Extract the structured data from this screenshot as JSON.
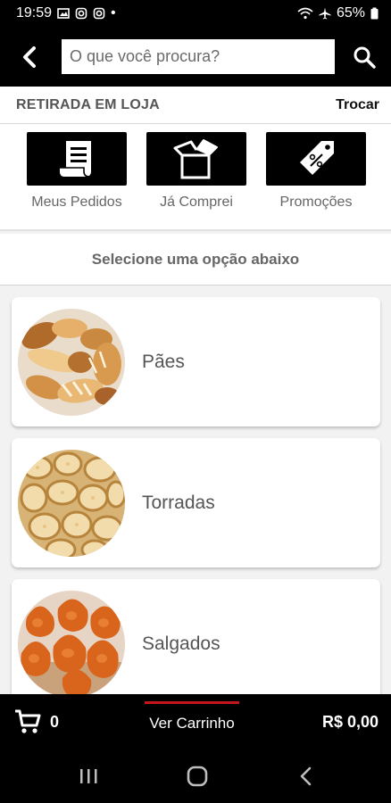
{
  "status_bar": {
    "time": "19:59",
    "dot": "•",
    "battery": "65%",
    "left_icons": [
      "image-icon",
      "instagram-icon",
      "instagram-icon"
    ],
    "right_icons": [
      "wifi-icon",
      "airplane-icon",
      "battery-icon"
    ]
  },
  "header": {
    "back_icon": "chevron-left-icon",
    "search_placeholder": "O que você procura?",
    "search_value": "",
    "search_icon": "search-icon"
  },
  "pickup": {
    "label": "RETIRADA EM LOJA",
    "change_label": "Trocar"
  },
  "shortcuts": [
    {
      "label": "Meus Pedidos",
      "icon": "receipt-icon"
    },
    {
      "label": "Já Comprei",
      "icon": "open-box-icon"
    },
    {
      "label": "Promoções",
      "icon": "discount-tag-icon"
    }
  ],
  "select_hint": "Selecione uma opção abaixo",
  "categories": [
    {
      "name": "Pães",
      "image": "bread-photo"
    },
    {
      "name": "Torradas",
      "image": "toast-photo"
    },
    {
      "name": "Salgados",
      "image": "coxinha-photo"
    }
  ],
  "cart": {
    "count": "0",
    "view_label": "Ver Carrinho",
    "total": "R$ 0,00",
    "icon": "cart-icon"
  },
  "nav": [
    "recent-apps-icon",
    "home-icon",
    "back-icon"
  ],
  "colors": {
    "header_bg": "#000000",
    "accent_red": "#c4161c",
    "page_bg": "#f2f2f2"
  }
}
